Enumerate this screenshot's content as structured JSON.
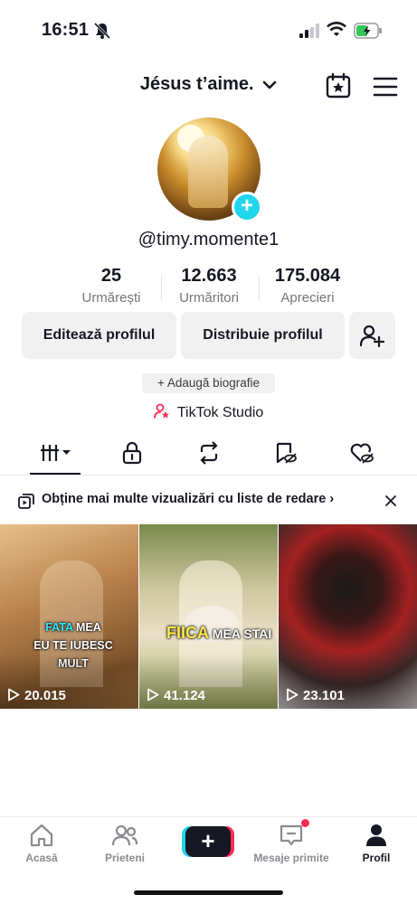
{
  "status_bar": {
    "time": "16:51"
  },
  "header": {
    "title": "Jésus t’aime."
  },
  "profile": {
    "username": "@timy.momente1",
    "stats": [
      {
        "value": "25",
        "label": "Urmărești"
      },
      {
        "value": "12.663",
        "label": "Urmăritori"
      },
      {
        "value": "175.084",
        "label": "Aprecieri"
      }
    ],
    "buttons": {
      "edit": "Editează profilul",
      "share": "Distribuie profilul"
    },
    "bio_prompt": "+ Adaugă biografie",
    "studio_label": "TikTok Studio"
  },
  "banner": {
    "text": "Obține mai multe vizualizări cu liste de redare"
  },
  "videos": [
    {
      "views": "20.015",
      "caption_hl": "FATA",
      "caption_1": " MEA",
      "caption_2": "EU TE IUBESC MULT"
    },
    {
      "views": "41.124",
      "caption_hl": "FIICA",
      "caption_1": " MEA STAI"
    },
    {
      "views": "23.101"
    }
  ],
  "nav": {
    "home": "Acasă",
    "friends": "Prieteni",
    "inbox": "Mesaje primite",
    "profile": "Profil"
  },
  "colors": {
    "accent_cyan": "#20d5ec",
    "accent_red": "#fe2c55",
    "text": "#161823",
    "muted": "#75767b"
  }
}
